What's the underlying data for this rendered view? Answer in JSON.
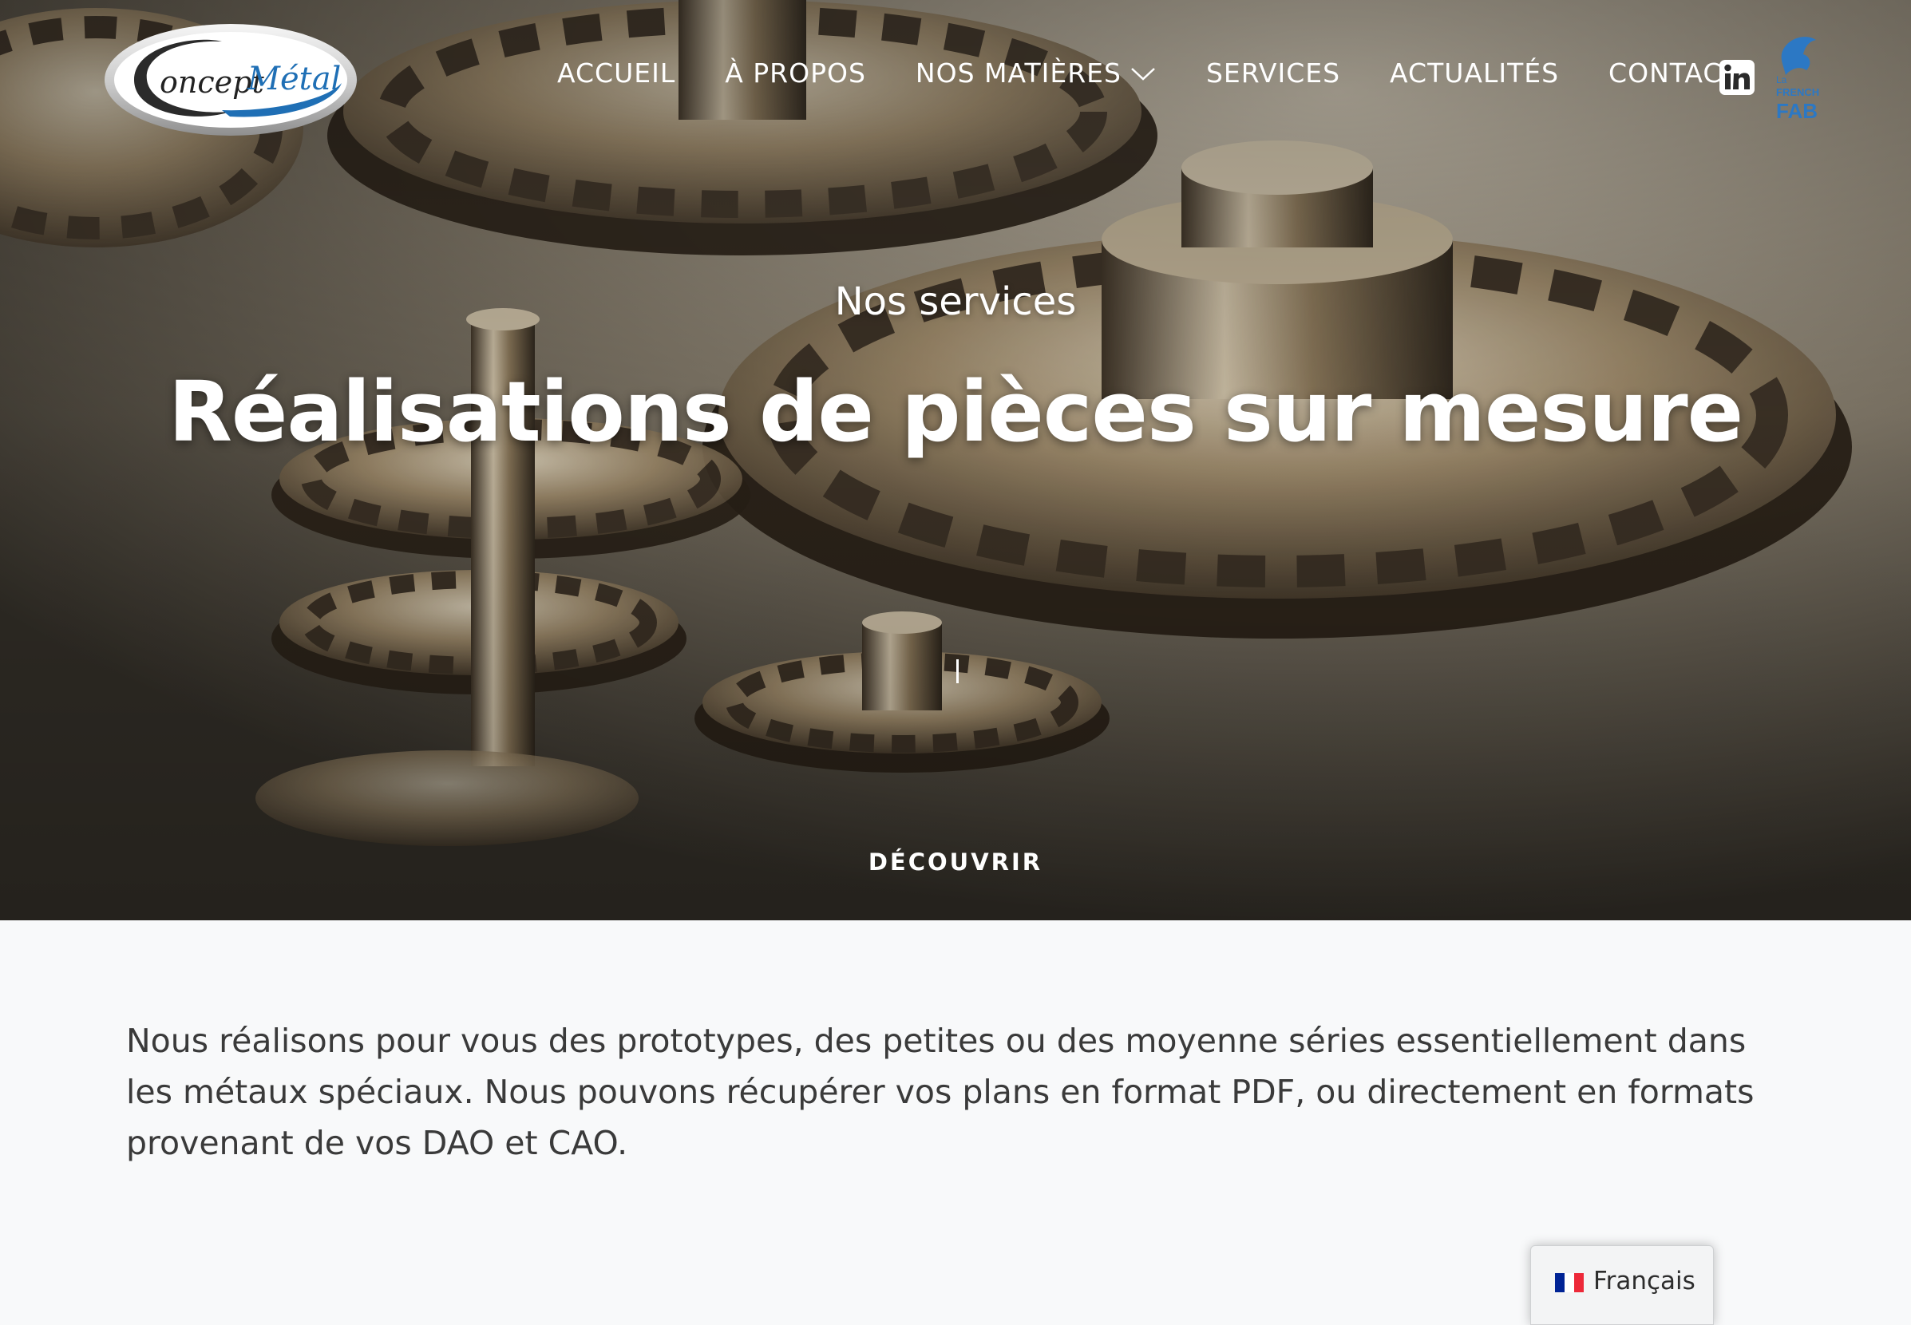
{
  "header": {
    "logo_text_prefix": "oncept",
    "logo_text_main": "Métal",
    "nav": [
      {
        "label": "ACCUEIL"
      },
      {
        "label": "À PROPOS"
      },
      {
        "label": "NOS MATIÈRES"
      },
      {
        "label": "SERVICES"
      },
      {
        "label": "ACTUALITÉS"
      },
      {
        "label": "CONTACT"
      }
    ],
    "frenchfab": {
      "line1": "La",
      "line2": "FRENCH",
      "line3": "FAB"
    }
  },
  "hero": {
    "eyebrow": "Nos services",
    "title": "Réalisations de pièces sur mesure",
    "cta": "DÉCOUVRIR"
  },
  "content": {
    "paragraph": "Nous réalisons pour vous des prototypes, des petites ou des moyenne séries essentiellement dans les métaux spéciaux. Nous pouvons récupérer vos plans en format PDF, ou directement en formats provenant de vos DAO et CAO."
  },
  "language": {
    "label": "Français",
    "flag": [
      "#002395",
      "#ffffff",
      "#ED2939"
    ]
  },
  "colors": {
    "logo_blue": "#1f6fb5",
    "frenchfab_blue": "#2c78c4",
    "content_text": "#3a3a3a",
    "page_bg": "#f8f9fa"
  }
}
